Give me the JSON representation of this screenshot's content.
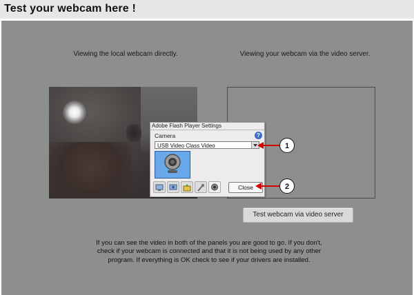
{
  "header": {
    "title": "Test your webcam here !"
  },
  "local": {
    "caption": "Viewing the local webcam directly."
  },
  "server": {
    "caption": "Viewing your webcam via the video server."
  },
  "test_button": {
    "label": "Test webcam via video server"
  },
  "info": {
    "text": "If you can see the video in both of the panels you are good to go. If you don't, check if your webcam is connected and that it is not being used by any other program. If everything is OK check to see if your drivers are installed."
  },
  "flash_dialog": {
    "title": "Adobe Flash Player Settings",
    "section_label": "Camera",
    "help_glyph": "?",
    "camera_select_value": "USB Video Class Video",
    "close_label": "Close",
    "tabs": [
      "display-icon",
      "privacy-icon",
      "storage-icon",
      "microphone-icon",
      "camera-icon"
    ]
  },
  "callouts": {
    "one": "1",
    "two": "2"
  },
  "colors": {
    "arrow": "#d40000",
    "preview_bg": "#6aa8ec",
    "stage_bg": "#8c8f8c"
  }
}
